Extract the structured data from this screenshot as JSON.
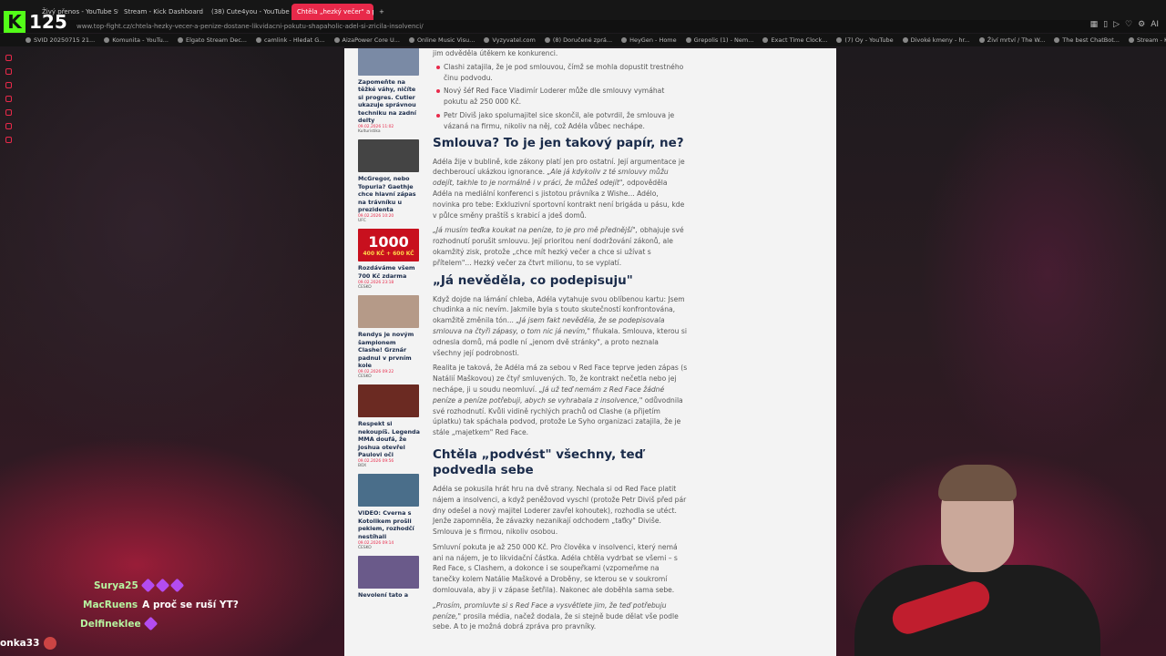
{
  "browser": {
    "tabs": [
      {
        "label": "Živý přenos - YouTube Stu",
        "active": false
      },
      {
        "label": "Stream - Kick Dashboard",
        "active": false
      },
      {
        "label": "(38) Cute4you - YouTube",
        "active": false
      },
      {
        "label": "Chtěla „hezký večer\" a pe",
        "active": true
      }
    ],
    "new_tab": "+",
    "url": "www.top-fight.cz/chtela-hezky-vecer-a-penize-dostane-likvidacni-pokutu-shapaholic-adel-si-zricila-insolvenci/",
    "bookmarks": [
      "SVID 20250715 21...",
      "Komunita - YouTu...",
      "Elgato Stream Dec...",
      "camlink - Hledat G...",
      "AizaPower Core U...",
      "Online Music Visu...",
      "Vyzyvatel.com",
      "(8) Doručené zprá...",
      "HeyGen - Home",
      "Grepolis (1) - Nem...",
      "Exact Time Clock...",
      "(7) Oy - YouTube",
      "Divoké kmeny - hr...",
      "Živí mrtví / The W...",
      "The best ChatBot...",
      "Stream - Kick Das..."
    ],
    "ai_label": "AI",
    "accent": "#e8294a"
  },
  "overlay": {
    "viewer_count": "125",
    "kick_logo": "K"
  },
  "sidebar_cards": [
    {
      "title": "Zapomeňte na těžké váhy, ničíte si progres. Cutler ukazuje správnou techniku na zadní delty",
      "date": "09.02.2026 11:02",
      "category": "Kulturistika",
      "color": "#7a8aa5"
    },
    {
      "title": "McGregor, nebo Topuria? Gaethje chce hlavní zápas na trávníku u prezidenta",
      "date": "09.02.2026 10:20",
      "category": "UFC",
      "color": "#444"
    },
    {
      "title": "Rozdáváme všem 700 Kč zdarma",
      "date": "09.02.2026 23:18",
      "category": "ČESKO",
      "color": "#c8101e",
      "banner": "1000",
      "banner_sub": "400 KČ + 600 KČ"
    },
    {
      "title": "Rendys je novým šampionem Clashe! Grznár padnul v prvním kole",
      "date": "09.02.2026 09:22",
      "category": "ČESKO",
      "color": "#b59a88"
    },
    {
      "title": "Respekt si nekoupíš. Legenda MMA doufá, že Joshua otevřel Paulovi oči",
      "date": "09.02.2026 09:56",
      "category": "BOX",
      "color": "#6b2a22"
    },
    {
      "title": "VIDEO: Cverna s Kotolikem prošli peklem, rozhodčí nestíhali",
      "date": "09.02.2026 09:14",
      "category": "ČESKO",
      "color": "#4a6e8a"
    },
    {
      "title": "Nevolení tato a",
      "date": "",
      "category": "",
      "color": "#6a5a8a"
    }
  ],
  "article": {
    "top_fragment": "jim odvěděla útěkem ke konkurenci.",
    "bullets": [
      "Clashi zatajila, že je pod smlouvou, čímž se mohla dopustit trestného činu podvodu.",
      "Nový šéf Red Face Vladimír Loderer může dle smlouvy vymáhat pokutu až 250 000 Kč.",
      "Petr Diviš jako spolumajitel sice skončil, ale potvrdil, že smlouva je vázaná na firmu, nikoliv na něj, což Adéla vůbec nechápe."
    ],
    "h1": "Smlouva? To je jen takový papír, ne?",
    "p1_a": "Adéla žije v bublině, kde zákony platí jen pro ostatní. Její argumentace je dechberoucí ukázkou ignorance. ",
    "p1_i": "„Ale já kdykoliv z té smlouvy můžu odejít, takhle to je normálně i v práci, že můžeš odejít\",",
    "p1_b": " odpověděla Adéla na mediální konferenci s jistotou právníka z Wishe... Adélo, novinka pro tebe: Exkluzivní sportovní kontrakt není brigáda u pásu, kde v půlce směny praštíš s krabicí a jdeš domů.",
    "p2_i": "„Já musím teďka koukat na peníze, to je pro mě přednější\",",
    "p2_b": " obhajuje své rozhodnutí porušit smlouvu. Její prioritou není dodržování zákonů, ale okamžitý zisk, protože „chce mít hezký večer a chce si užívat s přítelem\"... Hezký večer za čtvrt milionu, to se vyplatí.",
    "h2": "„Já nevěděla, co podepisuju\"",
    "p3_a": "Když dojde na lámání chleba, Adéla vytahuje svou oblíbenou kartu: Jsem chudinka a nic nevím. Jakmile byla s touto skutečností konfrontována, okamžitě změnila tón... ",
    "p3_i": "„Já jsem fakt nevěděla, že se podepisovala smlouva na čtyři zápasy, o tom nic já nevím,\"",
    "p3_b": " fňukala. Smlouva, kterou si odnesla domů, má podle ní „jenom dvě stránky\", a proto neznala všechny její podrobnosti.",
    "p4_a": "Realita je taková, že Adéla má za sebou v Red Face teprve jeden zápas (s Natálií Maškovou) ze čtyř smluvených. To, že kontrakt nečetla nebo jej nechápe, ji u soudu neomluví. ",
    "p4_i": "„Já už teď nemám z Red Face žádné peníze a peníze potřebuji, abych se vyhrabala z insolvence,\"",
    "p4_b": " odůvodnila své rozhodnutí. Kvůli vidině rychlých prachů od Clashe (a přijetím úplatku) tak spáchala podvod, protože Le Syho organizaci zatajila, že je stále „majetkem\" Red Face.",
    "h3": "Chtěla „podvést\" všechny, teď podvedla sebe",
    "p5": "Adéla se pokusila hrát hru na dvě strany. Nechala si od Red Face platit nájem a insolvenci, a když peněžovod vyschl (protože Petr Diviš před pár dny odešel a nový majitel Loderer zavřel kohoutek), rozhodla se utéct. Jenže zapomněla, že závazky nezanikají odchodem „taťky\" Diviše. Smlouva je s firmou, nikoliv osobou.",
    "p6": "Smluvní pokuta je až 250 000 Kč. Pro člověka v insolvenci, který nemá ani na nájem, je to likvidační částka. Adéla chtěla vydrbat se všemi – s Red Face, s Clashem, a dokonce i se soupeřkami (vzpomeňme na tanečky kolem Natálie Maškové a Droběny, se kterou se v soukromí domlouvala, aby ji v zápase šetřila). Nakonec ale doběhla sama sebe.",
    "p7_i": "„Prosím, promluvte si s Red Face a vysvětlete jim, že teď potřebuju peníze,\"",
    "p7_b": " prosila média, načež dodala, že si stejně bude dělat vše podle sebe. A to je možná dobrá zpráva pro pravníky."
  },
  "chat": [
    {
      "user": "Surya25",
      "message": "",
      "emotes": 3,
      "color": "#b7f5a0"
    },
    {
      "user": "MacRuens",
      "message": "A proč se ruší YT?",
      "emotes": 0,
      "color": "#b7f5a0"
    },
    {
      "user": "Delfineklee",
      "message": "",
      "emotes": 1,
      "color": "#b7f5a0"
    },
    {
      "user": "onka33",
      "message": "",
      "emotes": 0,
      "color": "#ffffff"
    }
  ]
}
